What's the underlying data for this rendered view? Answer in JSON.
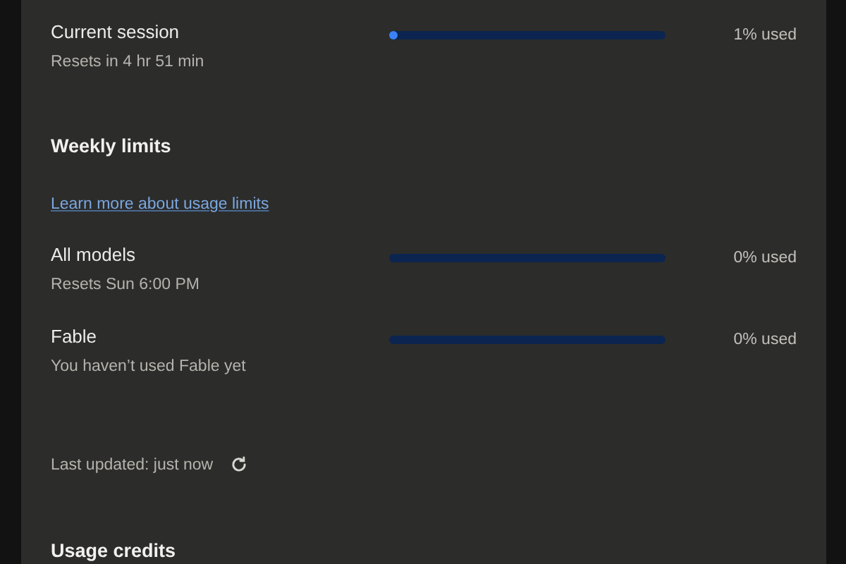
{
  "session": {
    "title": "Current session",
    "subtitle": "Resets in 4 hr 51 min",
    "level": 0.01,
    "reading": "1% used"
  },
  "weekly": {
    "heading": "Weekly limits",
    "link": "Learn more about usage limits",
    "limits": [
      {
        "title": "All models",
        "subtitle": "Resets Sun 6:00 PM",
        "level": 0,
        "reading": "0% used"
      },
      {
        "title": "Fable",
        "subtitle": "You haven’t used Fable yet",
        "level": 0,
        "reading": "0% used"
      }
    ]
  },
  "last_updated": "Last updated: just now",
  "credits": {
    "heading": "Usage credits"
  }
}
